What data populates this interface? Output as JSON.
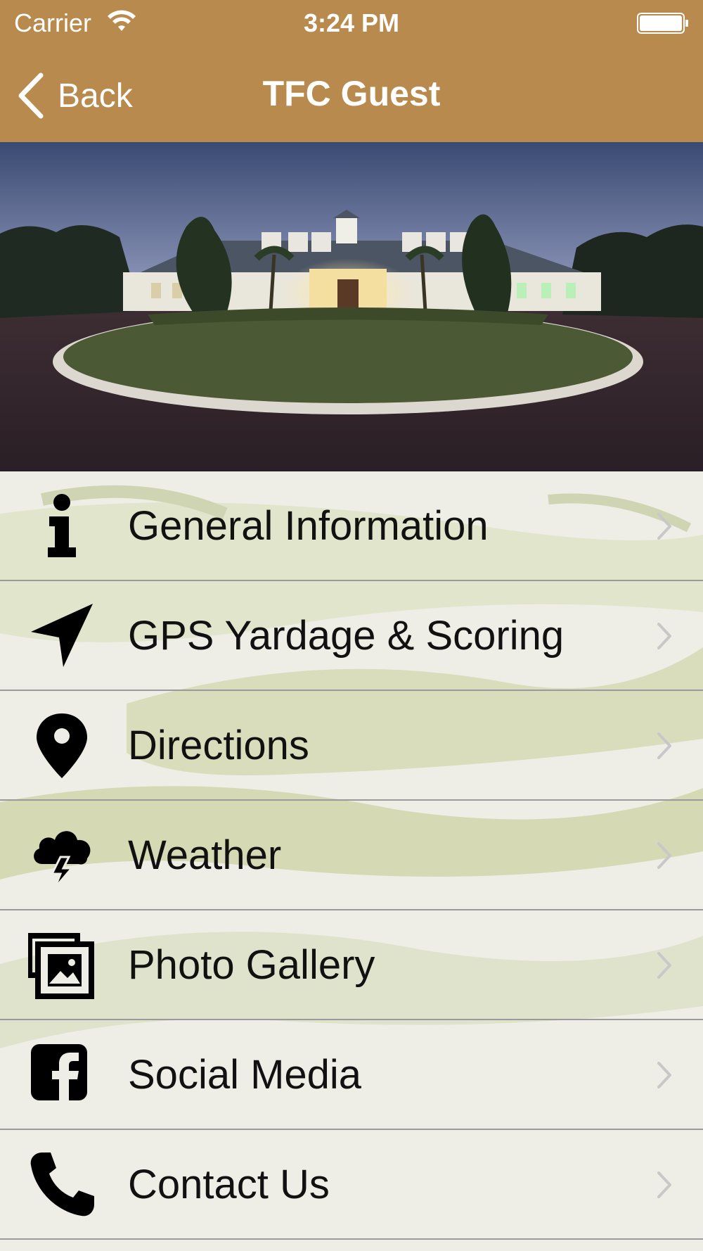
{
  "status_bar": {
    "carrier": "Carrier",
    "time": "3:24 PM"
  },
  "nav": {
    "back_label": "Back",
    "title": "TFC Guest"
  },
  "colors": {
    "nav_background": "#b98a4d",
    "nav_text": "#ffffff",
    "menu_text": "#111111",
    "separator": "#9a9a9a",
    "chevron": "#c8c8c8"
  },
  "hero": {
    "description_icon": "clubhouse-photo"
  },
  "menu": {
    "items": [
      {
        "label": "General Information",
        "icon": "info-icon"
      },
      {
        "label": "GPS Yardage & Scoring",
        "icon": "navigation-arrow-icon"
      },
      {
        "label": "Directions",
        "icon": "map-pin-icon"
      },
      {
        "label": "Weather",
        "icon": "storm-cloud-icon"
      },
      {
        "label": "Photo Gallery",
        "icon": "photo-gallery-icon"
      },
      {
        "label": "Social Media",
        "icon": "facebook-icon"
      },
      {
        "label": "Contact Us",
        "icon": "phone-icon"
      }
    ]
  }
}
